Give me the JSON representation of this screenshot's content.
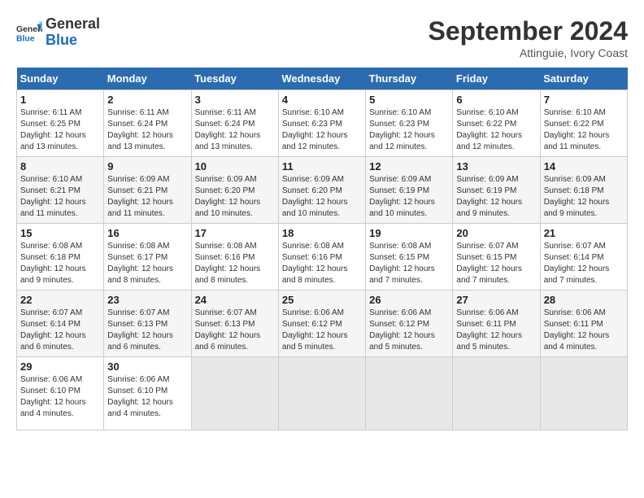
{
  "logo": {
    "text_general": "General",
    "text_blue": "Blue"
  },
  "title": "September 2024",
  "location": "Attinguie, Ivory Coast",
  "days_of_week": [
    "Sunday",
    "Monday",
    "Tuesday",
    "Wednesday",
    "Thursday",
    "Friday",
    "Saturday"
  ],
  "weeks": [
    [
      {
        "day": "1",
        "sunrise": "6:11 AM",
        "sunset": "6:25 PM",
        "daylight": "12 hours and 13 minutes."
      },
      {
        "day": "2",
        "sunrise": "6:11 AM",
        "sunset": "6:24 PM",
        "daylight": "12 hours and 13 minutes."
      },
      {
        "day": "3",
        "sunrise": "6:11 AM",
        "sunset": "6:24 PM",
        "daylight": "12 hours and 13 minutes."
      },
      {
        "day": "4",
        "sunrise": "6:10 AM",
        "sunset": "6:23 PM",
        "daylight": "12 hours and 12 minutes."
      },
      {
        "day": "5",
        "sunrise": "6:10 AM",
        "sunset": "6:23 PM",
        "daylight": "12 hours and 12 minutes."
      },
      {
        "day": "6",
        "sunrise": "6:10 AM",
        "sunset": "6:22 PM",
        "daylight": "12 hours and 12 minutes."
      },
      {
        "day": "7",
        "sunrise": "6:10 AM",
        "sunset": "6:22 PM",
        "daylight": "12 hours and 11 minutes."
      }
    ],
    [
      {
        "day": "8",
        "sunrise": "6:10 AM",
        "sunset": "6:21 PM",
        "daylight": "12 hours and 11 minutes."
      },
      {
        "day": "9",
        "sunrise": "6:09 AM",
        "sunset": "6:21 PM",
        "daylight": "12 hours and 11 minutes."
      },
      {
        "day": "10",
        "sunrise": "6:09 AM",
        "sunset": "6:20 PM",
        "daylight": "12 hours and 10 minutes."
      },
      {
        "day": "11",
        "sunrise": "6:09 AM",
        "sunset": "6:20 PM",
        "daylight": "12 hours and 10 minutes."
      },
      {
        "day": "12",
        "sunrise": "6:09 AM",
        "sunset": "6:19 PM",
        "daylight": "12 hours and 10 minutes."
      },
      {
        "day": "13",
        "sunrise": "6:09 AM",
        "sunset": "6:19 PM",
        "daylight": "12 hours and 9 minutes."
      },
      {
        "day": "14",
        "sunrise": "6:09 AM",
        "sunset": "6:18 PM",
        "daylight": "12 hours and 9 minutes."
      }
    ],
    [
      {
        "day": "15",
        "sunrise": "6:08 AM",
        "sunset": "6:18 PM",
        "daylight": "12 hours and 9 minutes."
      },
      {
        "day": "16",
        "sunrise": "6:08 AM",
        "sunset": "6:17 PM",
        "daylight": "12 hours and 8 minutes."
      },
      {
        "day": "17",
        "sunrise": "6:08 AM",
        "sunset": "6:16 PM",
        "daylight": "12 hours and 8 minutes."
      },
      {
        "day": "18",
        "sunrise": "6:08 AM",
        "sunset": "6:16 PM",
        "daylight": "12 hours and 8 minutes."
      },
      {
        "day": "19",
        "sunrise": "6:08 AM",
        "sunset": "6:15 PM",
        "daylight": "12 hours and 7 minutes."
      },
      {
        "day": "20",
        "sunrise": "6:07 AM",
        "sunset": "6:15 PM",
        "daylight": "12 hours and 7 minutes."
      },
      {
        "day": "21",
        "sunrise": "6:07 AM",
        "sunset": "6:14 PM",
        "daylight": "12 hours and 7 minutes."
      }
    ],
    [
      {
        "day": "22",
        "sunrise": "6:07 AM",
        "sunset": "6:14 PM",
        "daylight": "12 hours and 6 minutes."
      },
      {
        "day": "23",
        "sunrise": "6:07 AM",
        "sunset": "6:13 PM",
        "daylight": "12 hours and 6 minutes."
      },
      {
        "day": "24",
        "sunrise": "6:07 AM",
        "sunset": "6:13 PM",
        "daylight": "12 hours and 6 minutes."
      },
      {
        "day": "25",
        "sunrise": "6:06 AM",
        "sunset": "6:12 PM",
        "daylight": "12 hours and 5 minutes."
      },
      {
        "day": "26",
        "sunrise": "6:06 AM",
        "sunset": "6:12 PM",
        "daylight": "12 hours and 5 minutes."
      },
      {
        "day": "27",
        "sunrise": "6:06 AM",
        "sunset": "6:11 PM",
        "daylight": "12 hours and 5 minutes."
      },
      {
        "day": "28",
        "sunrise": "6:06 AM",
        "sunset": "6:11 PM",
        "daylight": "12 hours and 4 minutes."
      }
    ],
    [
      {
        "day": "29",
        "sunrise": "6:06 AM",
        "sunset": "6:10 PM",
        "daylight": "12 hours and 4 minutes."
      },
      {
        "day": "30",
        "sunrise": "6:06 AM",
        "sunset": "6:10 PM",
        "daylight": "12 hours and 4 minutes."
      },
      null,
      null,
      null,
      null,
      null
    ]
  ]
}
